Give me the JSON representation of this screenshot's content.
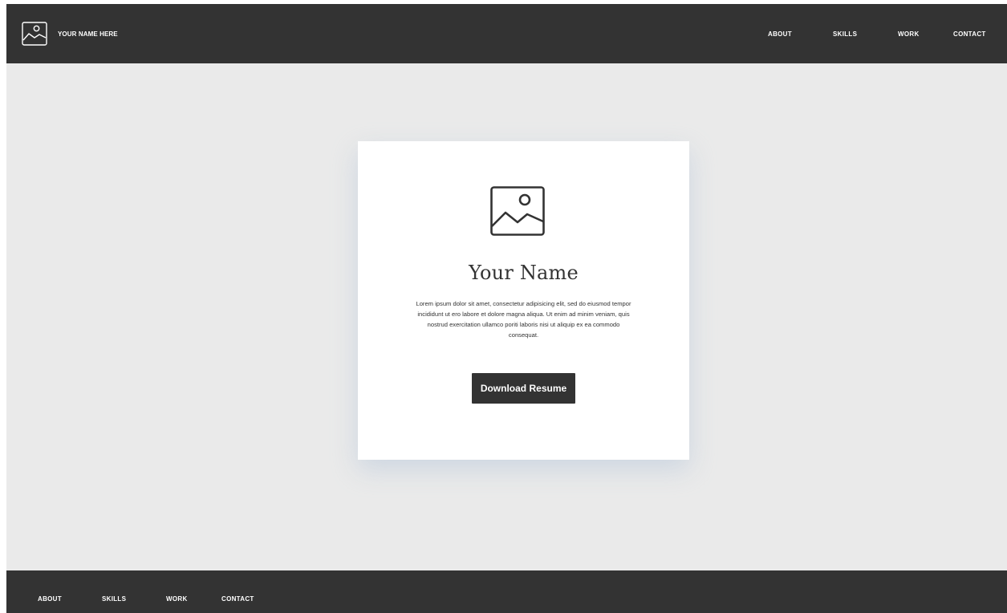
{
  "header": {
    "brand_name": "YOUR NAME HERE",
    "brand_icon": "image-icon",
    "nav": [
      {
        "label": "ABOUT"
      },
      {
        "label": "SKILLS"
      },
      {
        "label": "WORK"
      },
      {
        "label": "CONTACT"
      }
    ]
  },
  "hero": {
    "image_icon": "image-icon",
    "title": "Your Name",
    "body": "Lorem ipsum dolor sit amet, consectetur adipisicing elit, sed do eiusmod tempor incididunt ut ero labore et dolore magna aliqua. Ut enim ad minim veniam, quis nostrud exercitation ullamco poriti laboris nisi ut aliquip ex ea commodo consequat.",
    "button_label": "Download Resume"
  },
  "footer": {
    "nav": [
      {
        "label": "ABOUT"
      },
      {
        "label": "SKILLS"
      },
      {
        "label": "WORK"
      },
      {
        "label": "CONTACT"
      }
    ]
  },
  "colors": {
    "dark": "#333333",
    "page_background": "#eaeaea",
    "card_background": "#ffffff",
    "text_light": "#ffffff"
  }
}
